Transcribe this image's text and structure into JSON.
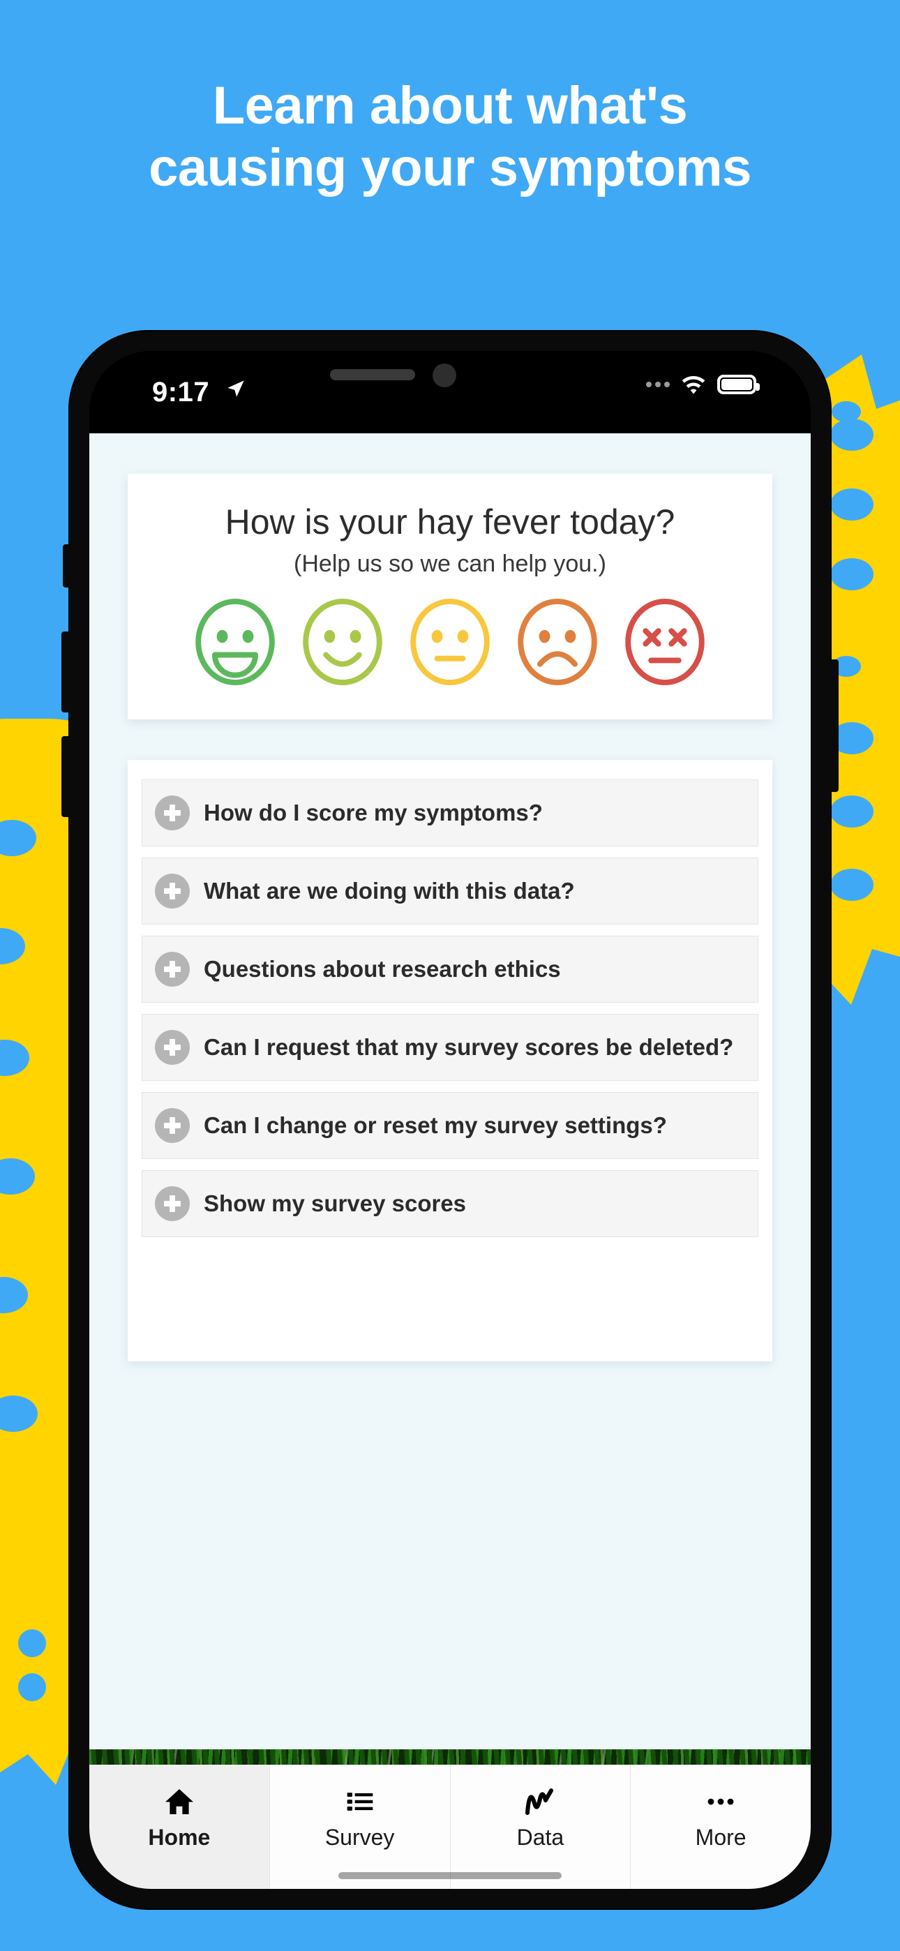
{
  "promo": {
    "headline": "Learn about what's\ncausing your symptoms",
    "background_color": "#3fa9f5",
    "accent_color": "#ffd400",
    "headline_color": "#ffffff"
  },
  "status_bar": {
    "time": "9:17",
    "location_icon": "location-arrow-icon",
    "signal_icon": "cellular-dots-icon",
    "wifi_icon": "wifi-icon",
    "battery_icon": "battery-full-icon"
  },
  "survey": {
    "question": "How is your hay fever today?",
    "subtitle": "(Help us so we can help you.)",
    "faces": [
      {
        "name": "face-very-happy",
        "mood": "very happy",
        "color": "#5cb85c"
      },
      {
        "name": "face-happy",
        "mood": "happy",
        "color": "#a6c council"
      },
      {
        "name": "face-neutral",
        "mood": "neutral",
        "color": "#f7c948"
      },
      {
        "name": "face-sad",
        "mood": "sad",
        "color": "#e08killing"
      },
      {
        "name": "face-very-sad",
        "mood": "very sad",
        "color": "#d9534f"
      }
    ],
    "face_colors": [
      "#5cb85c",
      "#a9c84a",
      "#f8c73e",
      "#e0803f",
      "#d64f48"
    ]
  },
  "faq": {
    "items": [
      {
        "label": "How do I score my symptoms?",
        "icon": "plus-circle-icon"
      },
      {
        "label": "What are we doing with this data?",
        "icon": "plus-circle-icon"
      },
      {
        "label": "Questions about research ethics",
        "icon": "plus-circle-icon"
      },
      {
        "label": "Can I request that my survey scores be deleted?",
        "icon": "plus-circle-icon"
      },
      {
        "label": "Can I change or reset my survey settings?",
        "icon": "plus-circle-icon"
      },
      {
        "label": "Show my survey scores",
        "icon": "plus-circle-icon"
      }
    ]
  },
  "tabbar": {
    "tabs": [
      {
        "label": "Home",
        "icon": "home-icon",
        "active": true
      },
      {
        "label": "Survey",
        "icon": "list-icon",
        "active": false
      },
      {
        "label": "Data",
        "icon": "chart-line-icon",
        "active": false
      },
      {
        "label": "More",
        "icon": "ellipsis-icon",
        "active": false
      }
    ]
  }
}
